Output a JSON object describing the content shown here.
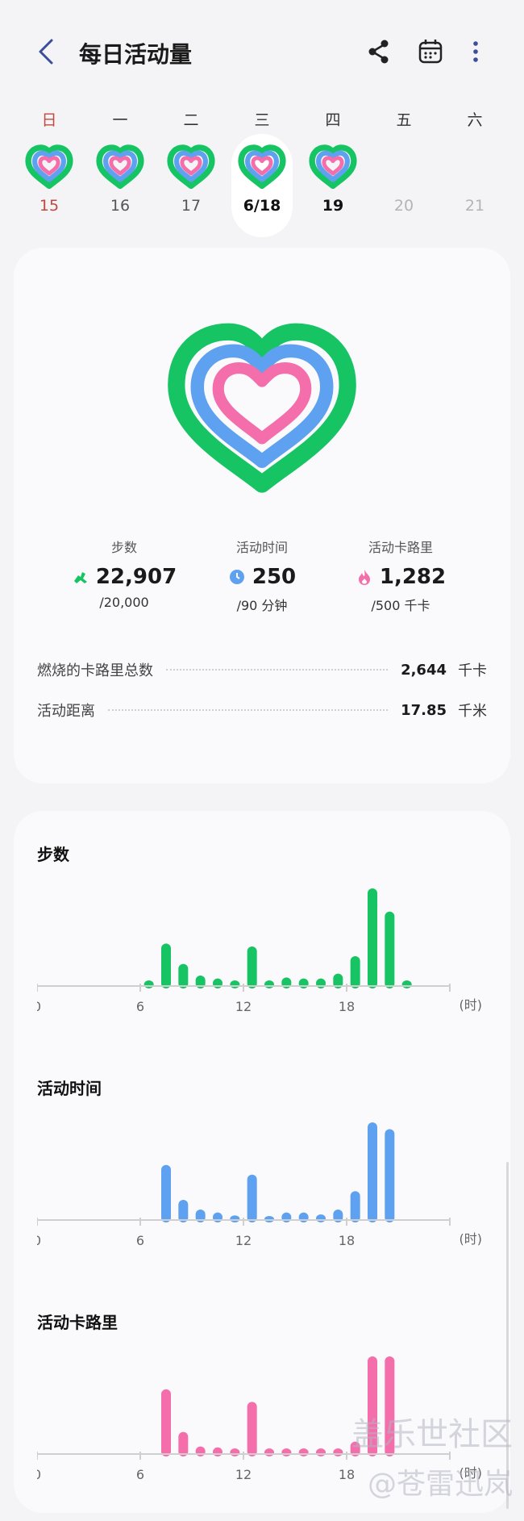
{
  "header": {
    "title": "每日活动量"
  },
  "week": {
    "days": [
      {
        "dow": "日",
        "num": "15",
        "heart": true,
        "style": "sun"
      },
      {
        "dow": "一",
        "num": "16",
        "heart": true,
        "style": "normal"
      },
      {
        "dow": "二",
        "num": "17",
        "heart": true,
        "style": "normal"
      },
      {
        "dow": "三",
        "num": "6/18",
        "heart": true,
        "style": "selected"
      },
      {
        "dow": "四",
        "num": "19",
        "heart": true,
        "style": "bold"
      },
      {
        "dow": "五",
        "num": "20",
        "heart": false,
        "style": "future"
      },
      {
        "dow": "六",
        "num": "21",
        "heart": false,
        "style": "future"
      }
    ]
  },
  "stats": {
    "steps": {
      "label": "步数",
      "value": "22,907",
      "goal": "/20,000"
    },
    "active_time": {
      "label": "活动时间",
      "value": "250",
      "goal": "/90 分钟"
    },
    "active_cal": {
      "label": "活动卡路里",
      "value": "1,282",
      "goal": "/500 千卡"
    }
  },
  "metrics": {
    "total_cal": {
      "label": "燃烧的卡路里总数",
      "value": "2,644",
      "unit": "千卡"
    },
    "distance": {
      "label": "活动距离",
      "value": "17.85",
      "unit": "千米"
    }
  },
  "colors": {
    "green": "#17c464",
    "blue": "#5ea1f0",
    "pink": "#f36eaa",
    "sun": "#c2473e"
  },
  "icons": {
    "back": "chevron-left-icon",
    "share": "share-icon",
    "calendar": "calendar-icon",
    "more": "more-vert-icon"
  },
  "chart_data": [
    {
      "type": "bar",
      "title": "步数",
      "color": "#17c464",
      "x": [
        6,
        7,
        8,
        9,
        10,
        11,
        12,
        13,
        14,
        15,
        16,
        17,
        18,
        19,
        20,
        21
      ],
      "values": [
        0.05,
        0.43,
        0.22,
        0.1,
        0.07,
        0.05,
        0.4,
        0.05,
        0.08,
        0.07,
        0.07,
        0.12,
        0.3,
        1.0,
        0.76,
        0.05
      ],
      "xticks": [
        "0",
        "6",
        "12",
        "18"
      ],
      "xunit": "(时)"
    },
    {
      "type": "bar",
      "title": "活动时间",
      "color": "#5ea1f0",
      "x": [
        7,
        8,
        9,
        10,
        11,
        12,
        13,
        14,
        15,
        16,
        17,
        18,
        19,
        20
      ],
      "values": [
        0.56,
        0.2,
        0.1,
        0.07,
        0.04,
        0.46,
        0.03,
        0.07,
        0.07,
        0.05,
        0.1,
        0.29,
        1.0,
        0.93
      ],
      "xticks": [
        "0",
        "6",
        "12",
        "18"
      ],
      "xunit": "(时)"
    },
    {
      "type": "bar",
      "title": "活动卡路里",
      "color": "#f36eaa",
      "x": [
        7,
        8,
        9,
        10,
        11,
        12,
        13,
        14,
        15,
        16,
        17,
        18,
        19,
        20
      ],
      "values": [
        0.66,
        0.22,
        0.07,
        0.06,
        0.05,
        0.53,
        0.05,
        0.05,
        0.05,
        0.05,
        0.05,
        0.12,
        1.0,
        1.0
      ],
      "xticks": [
        "0",
        "6",
        "12",
        "18"
      ],
      "xunit": "(时)"
    }
  ],
  "watermark": {
    "line1": "盖乐世社区",
    "line2": "@苍雷迅岚"
  }
}
